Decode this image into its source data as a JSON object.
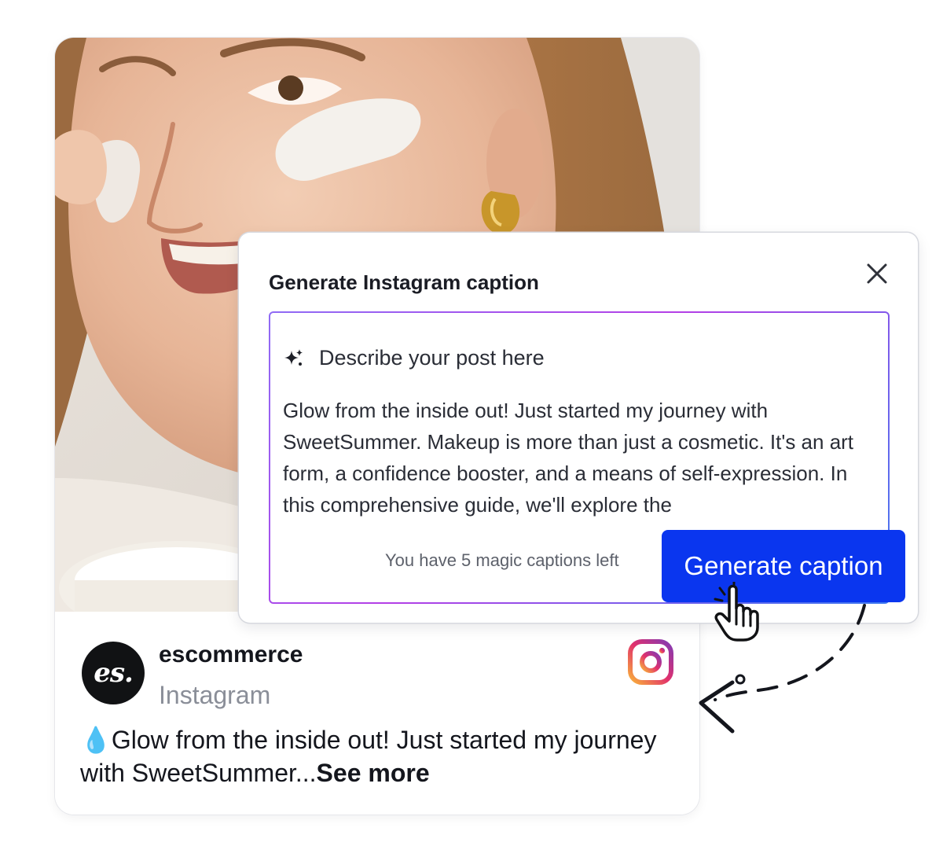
{
  "post": {
    "account_name": "escommerce",
    "platform": "Instagram",
    "avatar_text": "es.",
    "caption_emoji": "💧",
    "caption_text": "Glow from the inside out! Just started my journey with SweetSummer...",
    "see_more": "See more",
    "icons": {
      "platform_logo": "instagram-icon"
    }
  },
  "dialog": {
    "title": "Generate Instagram caption",
    "placeholder_label": "Describe your post here",
    "body_text": "Glow from the inside out! Just started my journey with SweetSummer. Makeup is more than just a cosmetic. It's an art form, a confidence booster, and a means of self-expression. In this comprehensive guide, we'll explore the",
    "captions_left": "You have 5 magic captions left",
    "generate_button": "Generate caption",
    "icons": {
      "close": "close-icon",
      "sparkle": "sparkle-icon",
      "cursor": "hand-pointer-icon"
    }
  },
  "colors": {
    "primary_button": "#0a36ef",
    "field_border_gradient": [
      "#8f6bf5",
      "#b43fe6",
      "#3f7bf0"
    ],
    "instagram_gradient": [
      "#f9b13a",
      "#e1306c",
      "#833ab4"
    ]
  }
}
